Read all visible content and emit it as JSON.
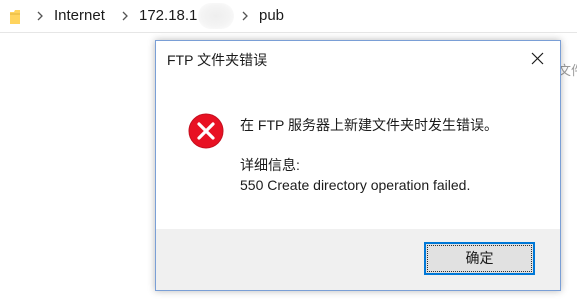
{
  "explorer": {
    "breadcrumb": [
      "Internet",
      "172.18.1",
      "pub"
    ],
    "background_peek_text": "文件"
  },
  "dialog": {
    "title": "FTP 文件夹错误",
    "message": "在 FTP 服务器上新建文件夹时发生错误。",
    "details_label": "详细信息:",
    "details_text": "550 Create directory operation failed.",
    "ok_label": "确定",
    "icon": "error-icon"
  },
  "colors": {
    "error_red": "#e81123",
    "focus_border": "#0078d7",
    "footer_bg": "#f0f0f0",
    "dialog_border": "#7a9fd6",
    "folder_yellow": "#ffd45e"
  }
}
